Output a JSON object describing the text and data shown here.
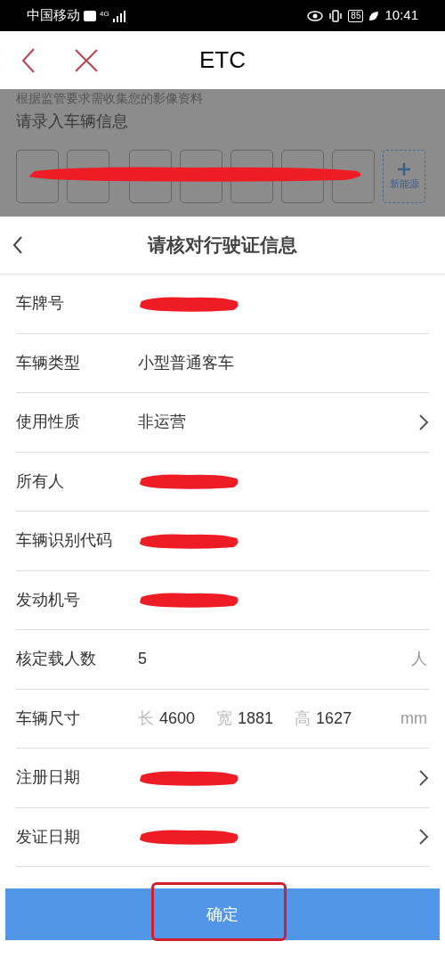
{
  "status_bar": {
    "carrier": "中国移动",
    "network": "4G",
    "battery": "85",
    "time": "10:41"
  },
  "header": {
    "title": "ETC"
  },
  "background_page": {
    "notice": "根据监管要求需收集您的影像资料",
    "section_title": "请录入车辆信息",
    "new_energy_label": "新能源"
  },
  "sheet": {
    "title": "请核对行驶证信息",
    "rows": [
      {
        "kind": "redacted",
        "label": "车牌号",
        "chevron": false
      },
      {
        "kind": "text",
        "label": "车辆类型",
        "value": "小型普通客车",
        "chevron": false
      },
      {
        "kind": "text",
        "label": "使用性质",
        "value": "非运营",
        "chevron": true
      },
      {
        "kind": "redacted",
        "label": "所有人",
        "chevron": false
      },
      {
        "kind": "redacted",
        "label": "车辆识别代码",
        "chevron": false
      },
      {
        "kind": "redacted",
        "label": "发动机号",
        "chevron": false
      },
      {
        "kind": "text",
        "label": "核定载人数",
        "value": "5",
        "unit": "人",
        "chevron": false
      },
      {
        "kind": "dimensions",
        "label": "车辆尺寸",
        "dims": [
          {
            "label": "长",
            "value": "4600"
          },
          {
            "label": "宽",
            "value": "1881"
          },
          {
            "label": "高",
            "value": "1627"
          }
        ],
        "unit": "mm",
        "chevron": false
      },
      {
        "kind": "redacted",
        "label": "注册日期",
        "chevron": true
      },
      {
        "kind": "redacted",
        "label": "发证日期",
        "chevron": true
      }
    ]
  },
  "confirm_button": {
    "label": "确定",
    "highlighted": true
  }
}
